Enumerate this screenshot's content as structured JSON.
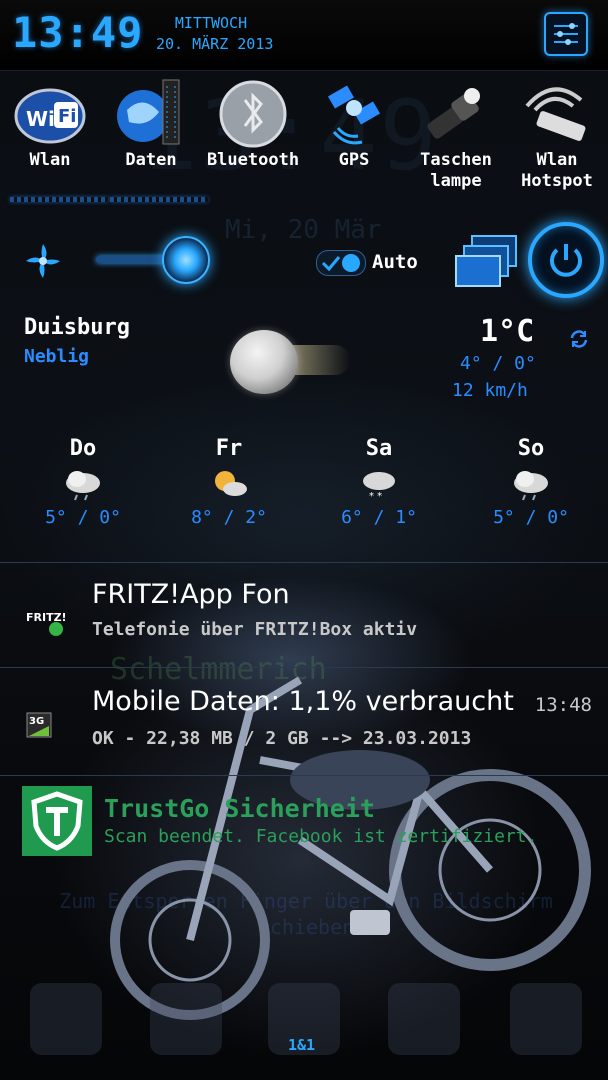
{
  "header": {
    "time": "13:49",
    "weekday": "MITTWOCH",
    "date": "20. MÄRZ 2013",
    "settings_icon": "settings-grid-icon"
  },
  "toggles": [
    {
      "label": "Wlan",
      "icon": "wifi-icon"
    },
    {
      "label": "Daten",
      "icon": "mobile-data-icon"
    },
    {
      "label": "Bluetooth",
      "icon": "bluetooth-icon"
    },
    {
      "label": "GPS",
      "icon": "gps-satellite-icon"
    },
    {
      "label": "Taschen\nlampe",
      "icon": "flashlight-icon"
    },
    {
      "label": "Wlan\nHotspot",
      "icon": "hotspot-router-icon"
    }
  ],
  "brightness": {
    "auto_label": "Auto",
    "auto_checked": true
  },
  "weather": {
    "city": "Duisburg",
    "condition": "Neblig",
    "temp_now": "1°C",
    "hilo_now": "4° / 0°",
    "wind": "12 km/h",
    "forecast": [
      {
        "day": "Do",
        "temps": "5° / 0°",
        "icon": "rain-cloud-icon"
      },
      {
        "day": "Fr",
        "temps": "8° / 2°",
        "icon": "partly-sunny-icon"
      },
      {
        "day": "Sa",
        "temps": "6° / 1°",
        "icon": "snow-cloud-icon"
      },
      {
        "day": "So",
        "temps": "5° / 0°",
        "icon": "rain-cloud-icon"
      }
    ]
  },
  "notifications": [
    {
      "title": "FRITZ!App Fon",
      "subtitle": "Telefonie über FRITZ!Box aktiv",
      "time": "",
      "icon": "fritz-app-icon"
    },
    {
      "title": "Mobile Daten: 1,1% verbraucht",
      "subtitle": "OK - 22,38 MB / 2 GB --> 23.03.2013",
      "time": "13:48",
      "icon": "3g-data-icon"
    },
    {
      "title": "TrustGo Sicherheit",
      "subtitle": "Scan beendet. Facebook ist zertifiziert.",
      "time": "",
      "icon": "trustgo-shield-icon"
    }
  ],
  "background": {
    "ghost_clock": "13:49",
    "ghost_date": "Mi, 20 Mär",
    "ghost_name": "Schelmmerich",
    "ghost_text": "Zum Entsperren Finger über den Bildschirm schieben"
  },
  "carrier": "1&1",
  "colors": {
    "accent": "#2aa8ff",
    "link": "#2a8cff",
    "trustgo": "#2aa05a"
  }
}
